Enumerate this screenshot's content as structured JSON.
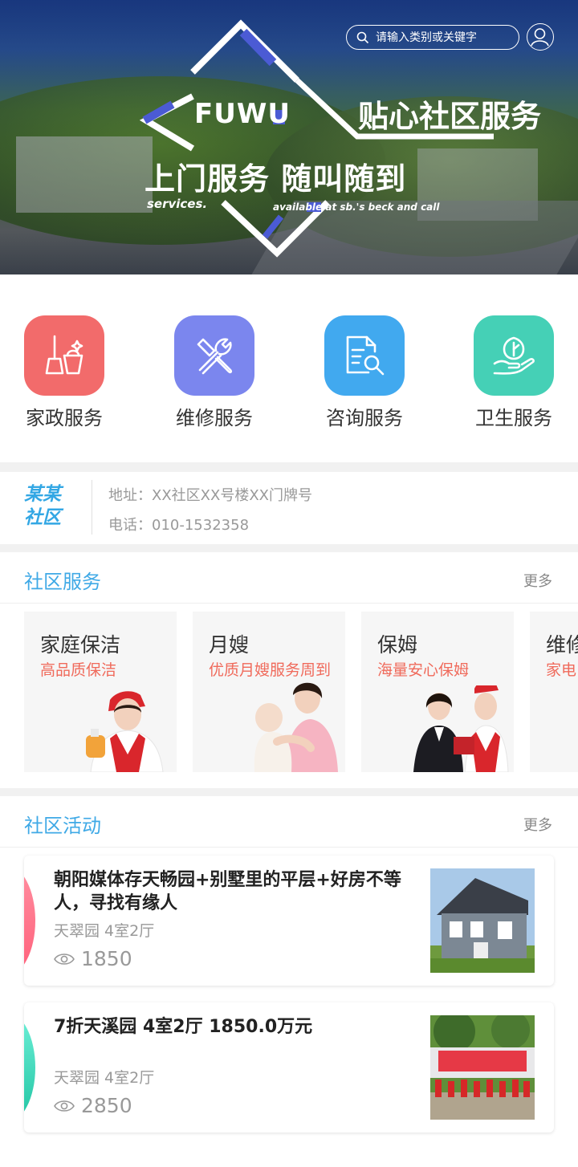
{
  "header": {
    "search_placeholder": "请输入类别或关键字",
    "banner": {
      "logo_text": "FUWU",
      "headline": "贴心社区服务",
      "subheadline": "上门服务  随叫随到",
      "en_left": "services.",
      "en_right": "available at sb.'s beck and call"
    }
  },
  "quick_services": [
    {
      "label": "家政服务",
      "icon": "broom-bucket-icon",
      "color": "#f26b6b"
    },
    {
      "label": "维修服务",
      "icon": "tools-icon",
      "color": "#7b86ee"
    },
    {
      "label": "咨询服务",
      "icon": "document-search-icon",
      "color": "#41a9ef"
    },
    {
      "label": "卫生服务",
      "icon": "hand-leaf-icon",
      "color": "#45d0b6"
    }
  ],
  "community": {
    "logo_line1": "某某",
    "logo_line2": "社区",
    "address": "地址：XX社区XX号楼XX门牌号",
    "phone": "电话：010-1532358"
  },
  "services_section": {
    "title": "社区服务",
    "more": "更多",
    "cards": [
      {
        "title": "家庭保洁",
        "subtitle": "高品质保洁"
      },
      {
        "title": "月嫂",
        "subtitle": "优质月嫂服务周到"
      },
      {
        "title": "保姆",
        "subtitle": "海量安心保姆"
      },
      {
        "title": "维修",
        "subtitle": "家电"
      }
    ]
  },
  "activities_section": {
    "title": "社区活动",
    "more": "更多",
    "items": [
      {
        "title": "朝阳媒体存天畅园+别墅里的平层+好房不等人，寻找有缘人",
        "subtitle": "天翠园 4室2厅",
        "views": "1850",
        "accent": "#ff6f86"
      },
      {
        "title": "7折天溪园 4室2厅 1850.0万元",
        "subtitle": "天翠园 4室2厅",
        "views": "2850",
        "accent": "#2fd3b0"
      }
    ]
  }
}
